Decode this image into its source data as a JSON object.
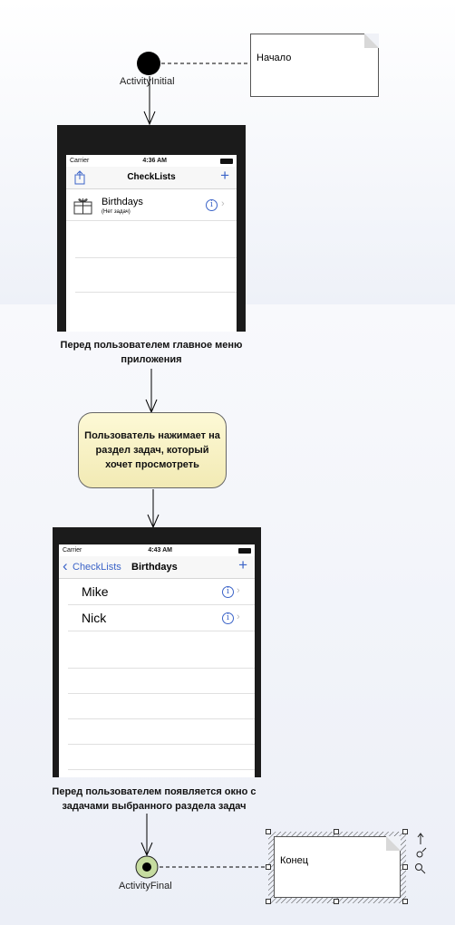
{
  "nodes": {
    "initial_label": "ActivityInitial",
    "final_label": "ActivityFinal",
    "note_start": "Начало",
    "note_end": "Конец",
    "action_text": "Пользователь нажимает на раздел задач, который хочет просмотреть",
    "caption_1": "Перед пользователем главное меню приложения",
    "caption_2": "Перед пользователем появляется окно с задачами выбранного раздела задач"
  },
  "screen1": {
    "carrier": "Carrier",
    "time": "4:36 AM",
    "title": "CheckLists",
    "add": "+",
    "item_title": "Birthdays",
    "item_subtitle": "(Нет задач)"
  },
  "screen2": {
    "carrier": "Carrier",
    "time": "4:43 AM",
    "back": "CheckLists",
    "title": "Birthdays",
    "add": "+",
    "items": [
      "Mike",
      "Nick"
    ]
  },
  "colors": {
    "initial_node": "#000000",
    "final_node_ring": "#c6dca0",
    "action_fill": "#f8f2c4",
    "ios_blue": "#3c64c8"
  }
}
